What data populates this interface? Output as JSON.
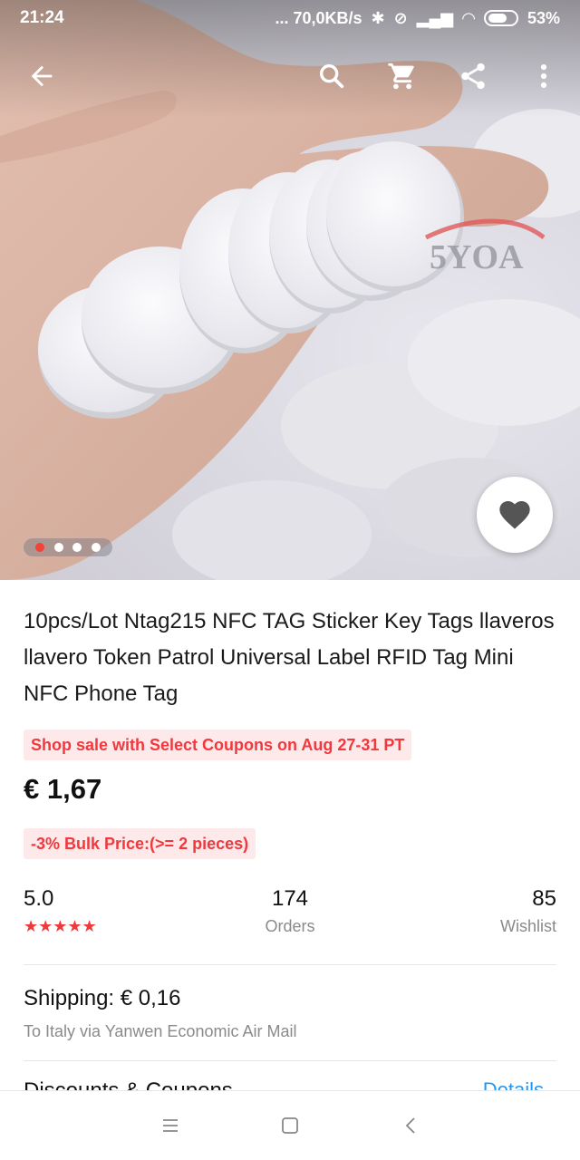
{
  "status_bar": {
    "time": "21:24",
    "network_speed": "... 70,0KB/s",
    "battery": "53%"
  },
  "toolbar": {
    "back_icon": "arrow-left-icon",
    "search_icon": "search-icon",
    "cart_icon": "cart-icon",
    "share_icon": "share-icon",
    "more_icon": "more-vertical-icon"
  },
  "gallery": {
    "watermark": "5YOA",
    "total_images": 4,
    "current_index": 1
  },
  "product": {
    "title": "10pcs/Lot Ntag215 NFC TAG Sticker Key Tags llaveros llavero Token Patrol Universal Label RFID Tag Mini NFC Phone Tag",
    "promo": "Shop sale with Select Coupons on Aug 27-31 PT",
    "price": "€ 1,67",
    "bulk_price": "-3% Bulk Price:(>= 2 pieces)"
  },
  "stats": {
    "rating_value": "5.0",
    "rating_stars": "★★★★★",
    "orders_value": "174",
    "orders_label": "Orders",
    "wishlist_value": "85",
    "wishlist_label": "Wishlist"
  },
  "shipping": {
    "title": "Shipping: € 0,16",
    "subtitle": "To Italy via Yanwen Economic Air Mail"
  },
  "next_section": {
    "left_text": "Discounts & Coupons",
    "right_text": "Details"
  },
  "colors": {
    "accent": "#f0383d",
    "promo_bg": "#fde9ea",
    "link": "#2196f3"
  }
}
